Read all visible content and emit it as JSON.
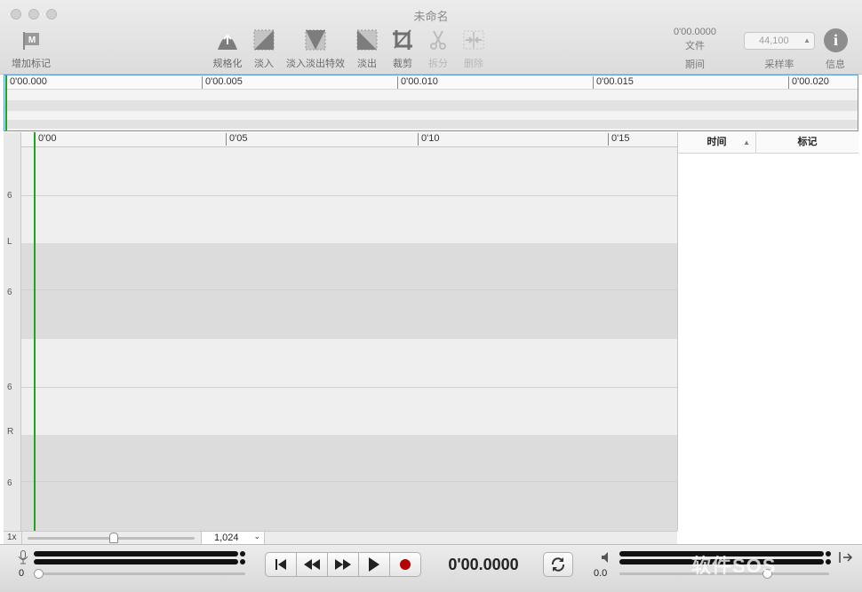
{
  "window": {
    "title": "未命名"
  },
  "toolbar": {
    "add_marker": "增加标记",
    "normalize": "规格化",
    "fade_in": "淡入",
    "crossfade": "淡入淡出特效",
    "fade_out": "淡出",
    "crop": "裁剪",
    "split": "拆分",
    "delete": "删除",
    "file_time": "0'00.0000",
    "file_label": "文件",
    "duration_label": "期间",
    "sample_rate_value": "44,100",
    "sample_rate_label": "采样率",
    "info_label": "信息",
    "add_marker_badge": "M"
  },
  "overview": {
    "ruler": [
      "0'00.000",
      "0'00.005",
      "0'00.010",
      "0'00.015",
      "0'00.020"
    ]
  },
  "main_ruler": [
    "0'00",
    "0'05",
    "0'10",
    "0'15"
  ],
  "channels": {
    "left": {
      "label": "L",
      "scale_top": "6",
      "scale_bottom": "6"
    },
    "right": {
      "label": "R",
      "scale_top": "6",
      "scale_bottom": "6"
    }
  },
  "markers_panel": {
    "col_time": "时间",
    "col_marker": "标记",
    "sort_icon": "chevron-up-icon"
  },
  "zoom": {
    "level": "1x",
    "samples": "1,024"
  },
  "transport": {
    "input_level": "0",
    "time_display": "0'00.0000",
    "output_level": "0.0",
    "record_color": "#b30000"
  },
  "watermark": "软件SOS",
  "colors": {
    "playhead": "#1ea51e",
    "selection_border": "#5b9bd5"
  }
}
